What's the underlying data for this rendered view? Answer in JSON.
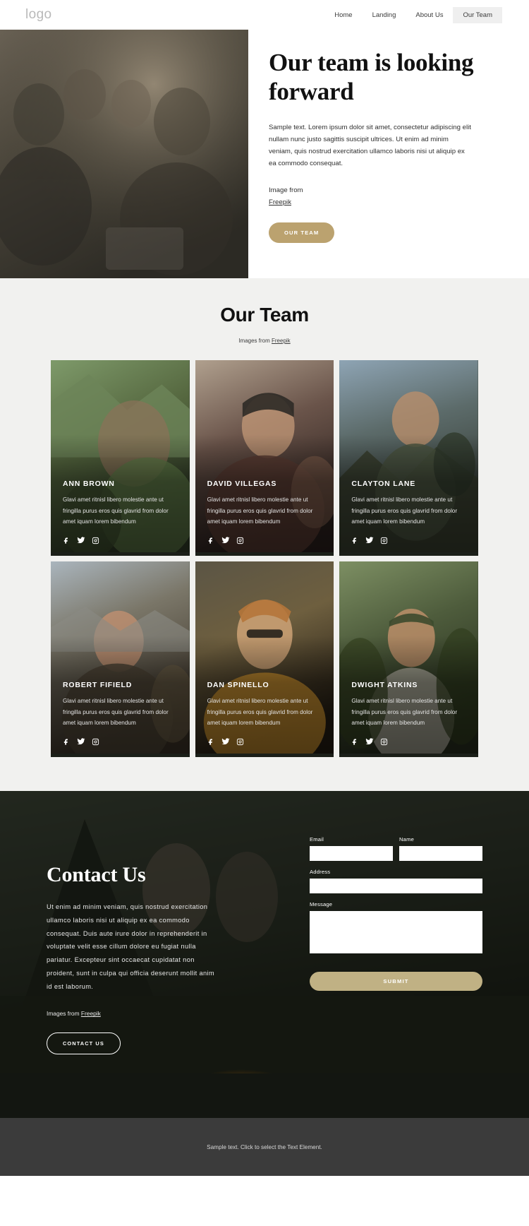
{
  "nav": {
    "logo": "logo",
    "links": [
      {
        "label": "Home",
        "active": false
      },
      {
        "label": "Landing",
        "active": false
      },
      {
        "label": "About Us",
        "active": false
      },
      {
        "label": "Our Team",
        "active": true
      }
    ]
  },
  "hero": {
    "title": "Our team is looking forward",
    "body": "Sample text. Lorem ipsum dolor sit amet, consectetur adipiscing elit nullam nunc justo sagittis suscipit ultrices. Ut enim ad minim veniam, quis nostrud exercitation ullamco laboris nisi ut aliquip ex ea commodo consequat.",
    "credit_label": "Image from",
    "credit_link": "Freepik",
    "cta_label": "OUR TEAM",
    "cta_color": "#bba26f",
    "image_alt": "group-of-friends-around-tablet"
  },
  "team": {
    "heading": "Our Team",
    "sub_prefix": "Images from ",
    "sub_link": "Freepik",
    "members": [
      {
        "name": "ANN BROWN",
        "desc": "Glavi amet ritnisl libero molestie ante ut fringilla purus eros quis glavrid from dolor amet iquam lorem bibendum",
        "image_alt": "woman-with-camera-in-mountains"
      },
      {
        "name": "DAVID VILLEGAS",
        "desc": "Glavi amet ritnisl libero molestie ante ut fringilla purus eros quis glavrid from dolor amet iquam lorem bibendum",
        "image_alt": "man-with-beanie-holding-mug"
      },
      {
        "name": "CLAYTON LANE",
        "desc": "Glavi amet ritnisl libero molestie ante ut fringilla purus eros quis glavrid from dolor amet iquam lorem bibendum",
        "image_alt": "smiling-hiker-with-backpack-at-sunset"
      },
      {
        "name": "ROBERT FIFIELD",
        "desc": "Glavi amet ritnisl libero molestie ante ut fringilla purus eros quis glavrid from dolor amet iquam lorem bibendum",
        "image_alt": "laughing-hiker-in-mountains"
      },
      {
        "name": "DAN SPINELLO",
        "desc": "Glavi amet ritnisl libero molestie ante ut fringilla purus eros quis glavrid from dolor amet iquam lorem bibendum",
        "image_alt": "bearded-man-with-glasses-yellow-jacket"
      },
      {
        "name": "DWIGHT ATKINS",
        "desc": "Glavi amet ritnisl libero molestie ante ut fringilla purus eros quis glavrid from dolor amet iquam lorem bibendum",
        "image_alt": "man-with-cap-in-forest"
      }
    ],
    "social_icons": [
      "facebook-icon",
      "twitter-icon",
      "instagram-icon"
    ]
  },
  "contact": {
    "title": "Contact Us",
    "body": "Ut enim ad minim veniam, quis nostrud exercitation ullamco laboris nisi ut aliquip ex ea commodo consequat. Duis aute irure dolor in reprehenderit in voluptate velit esse cillum dolore eu fugiat nulla pariatur. Excepteur sint occaecat cupidatat non proident, sunt in culpa qui officia deserunt mollit anim id est laborum.",
    "credit_prefix": "Images from ",
    "credit_link": "Freepik",
    "cta_label": "CONTACT US",
    "image_alt": "couple-by-tent-and-campfire",
    "form": {
      "email_label": "Email",
      "email_value": "",
      "email_placeholder": "",
      "name_label": "Name",
      "name_value": "",
      "name_placeholder": "",
      "address_label": "Address",
      "address_value": "",
      "address_placeholder": "",
      "message_label": "Message",
      "message_value": "",
      "message_placeholder": "",
      "submit_label": "SUBMIT",
      "submit_color": "#c0b184"
    }
  },
  "footer": {
    "text": "Sample text. Click to select the Text Element."
  }
}
